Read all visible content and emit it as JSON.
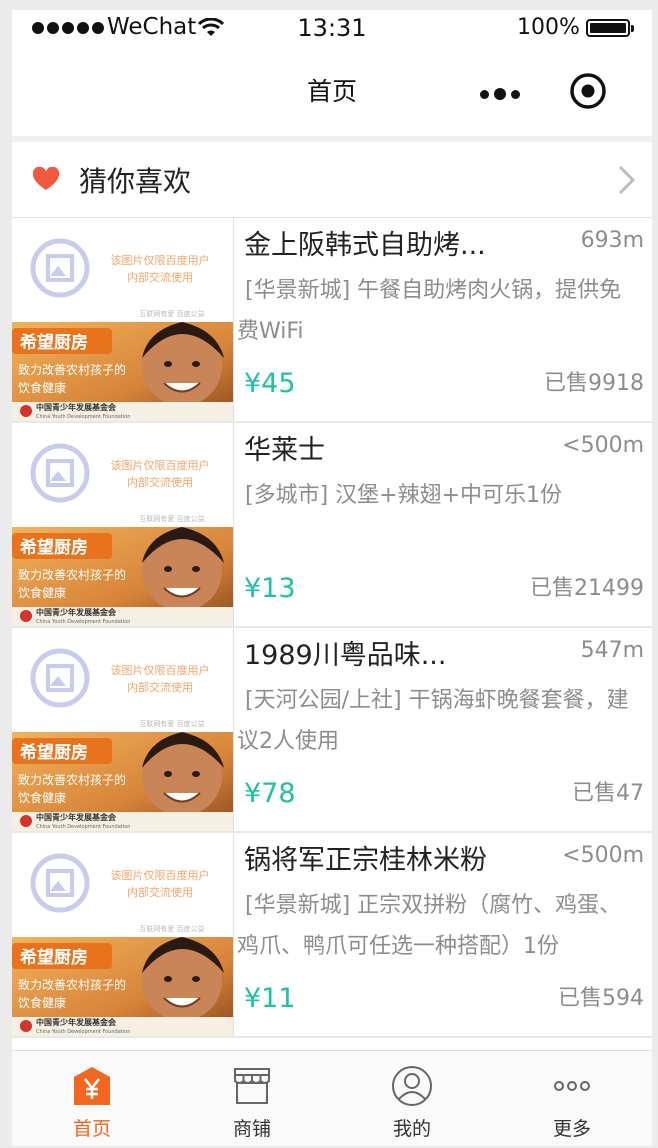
{
  "status_bar": {
    "carrier": "WeChat",
    "time": "13:31",
    "battery": "100%"
  },
  "nav": {
    "title": "首页"
  },
  "section": {
    "title": "猜你喜欢"
  },
  "thumbnail": {
    "watermark_line1": "该图片仅限百度用户",
    "watermark_line2": "内部交流使用",
    "footer_note": "互联网有爱 百度公益",
    "banner_title": "希望厨房",
    "banner_slogan_1": "致力改善农村孩子的",
    "banner_slogan_2": "饮食健康",
    "foundation_cn": "中国青少年发展基金会",
    "foundation_en": "China Youth Development Foundation"
  },
  "items": [
    {
      "name": "金上阪韩式自助烤...",
      "distance": "693m",
      "desc": "[华景新城] 午餐自助烤肉火锅，提供免费WiFi",
      "price": "¥45",
      "sold": "已售9918"
    },
    {
      "name": "华莱士",
      "distance": "<500m",
      "desc": "[多城市] 汉堡+辣翅+中可乐1份",
      "price": "¥13",
      "sold": "已售21499"
    },
    {
      "name": "1989川粤品味...",
      "distance": "547m",
      "desc": "[天河公园/上社] 干锅海虾晚餐套餐，建议2人使用",
      "price": "¥78",
      "sold": "已售47"
    },
    {
      "name": "锅将军正宗桂林米粉",
      "distance": "<500m",
      "desc": "[华景新城] 正宗双拼粉（腐竹、鸡蛋、鸡爪、鸭爪可任选一种搭配）1份",
      "price": "¥11",
      "sold": "已售594"
    }
  ],
  "tabs": [
    {
      "label": "首页",
      "icon": "yen-shop-icon",
      "active": true
    },
    {
      "label": "商铺",
      "icon": "store-icon",
      "active": false
    },
    {
      "label": "我的",
      "icon": "user-icon",
      "active": false
    },
    {
      "label": "更多",
      "icon": "more-dots-icon",
      "active": false
    }
  ],
  "colors": {
    "accent": "#f2661f",
    "price": "#1ec2a0",
    "heart": "#f0583f",
    "muted": "#8d8d8d"
  }
}
